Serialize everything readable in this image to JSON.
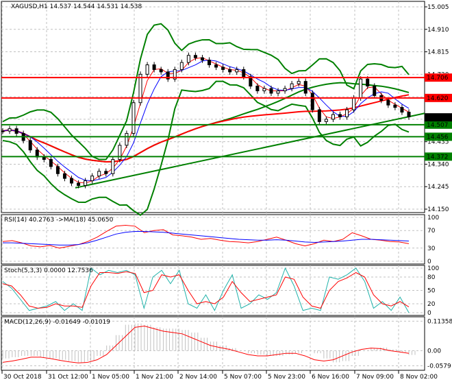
{
  "title": "XAGUSD,H1",
  "ohlc": {
    "open": "14.537",
    "high": "14.544",
    "low": "14.531",
    "close": "14.538"
  },
  "colors": {
    "bull": "#000000",
    "bear": "#000000",
    "band": "#008000",
    "ma": "#ff0000",
    "hline_red": "#ff0000",
    "hline_green": "#008000",
    "rsi": "#ff0000",
    "rsi_ma": "#0000ff",
    "stoch_main": "#20b2aa",
    "stoch_signal": "#ff0000",
    "macd_hist": "#c0c0c0",
    "macd_signal": "#ff0000"
  },
  "chart_data": [
    {
      "type": "candlestick",
      "name": "XAGUSD,H1",
      "ylim": [
        14.15,
        15.005
      ],
      "y_ticks": [
        "15.005",
        "14.910",
        "14.815",
        "14.720",
        "14.625",
        "14.530",
        "14.435",
        "14.340",
        "14.245",
        "14.150"
      ],
      "closes": [
        14.48,
        14.49,
        14.47,
        14.44,
        14.4,
        14.37,
        14.36,
        14.33,
        14.3,
        14.28,
        14.26,
        14.25,
        14.27,
        14.29,
        14.31,
        14.3,
        14.36,
        14.42,
        14.47,
        14.6,
        14.72,
        14.76,
        14.74,
        14.73,
        14.7,
        14.74,
        14.77,
        14.8,
        14.79,
        14.78,
        14.76,
        14.75,
        14.74,
        14.73,
        14.74,
        14.71,
        14.67,
        14.65,
        14.66,
        14.64,
        14.65,
        14.66,
        14.68,
        14.69,
        14.64,
        14.57,
        14.52,
        14.53,
        14.55,
        14.54,
        14.57,
        14.62,
        14.7,
        14.67,
        14.63,
        14.61,
        14.59,
        14.58,
        14.56,
        14.54
      ],
      "levels": [
        {
          "value": "14.706",
          "color": "red"
        },
        {
          "value": "14.620",
          "color": "red"
        },
        {
          "value": "14.507",
          "color": "green"
        },
        {
          "value": "14.456",
          "color": "green"
        },
        {
          "value": "14.372",
          "color": "green"
        }
      ],
      "current": "14.538"
    },
    {
      "type": "line",
      "name": "RSI(14)",
      "label": "RSI(14) 40.2763  ->MA(18) 45.0650",
      "ylim": [
        0,
        100
      ],
      "y_ticks": [
        "100",
        "70",
        "30",
        "0"
      ],
      "rsi": [
        45,
        47,
        42,
        35,
        33,
        36,
        30,
        34,
        38,
        45,
        55,
        68,
        80,
        82,
        80,
        65,
        70,
        72,
        60,
        58,
        55,
        50,
        52,
        48,
        45,
        44,
        42,
        45,
        50,
        55,
        48,
        40,
        35,
        40,
        48,
        45,
        50,
        65,
        58,
        50,
        48,
        45,
        44,
        40
      ],
      "ma": [
        42,
        42,
        41,
        40,
        39,
        38,
        37,
        37,
        38,
        42,
        48,
        55,
        62,
        66,
        68,
        68,
        67,
        66,
        64,
        62,
        60,
        58,
        56,
        54,
        52,
        50,
        49,
        48,
        48,
        49,
        48,
        46,
        44,
        43,
        44,
        45,
        46,
        48,
        50,
        50,
        49,
        48,
        47,
        46
      ]
    },
    {
      "type": "line",
      "name": "Stoch(5,3,3)",
      "label": "Stoch(5,3,3) 0.0000 12.7536",
      "ylim": [
        0,
        100
      ],
      "y_ticks": [
        "100",
        "80",
        "50",
        "20",
        "0"
      ],
      "main": [
        70,
        55,
        30,
        5,
        10,
        15,
        25,
        5,
        20,
        5,
        100,
        85,
        95,
        90,
        95,
        85,
        10,
        80,
        95,
        65,
        95,
        20,
        10,
        40,
        5,
        50,
        85,
        10,
        20,
        40,
        30,
        45,
        100,
        60,
        5,
        10,
        5,
        80,
        75,
        85,
        100,
        70,
        10,
        25,
        5,
        35,
        0
      ],
      "signal": [
        65,
        60,
        40,
        15,
        10,
        12,
        20,
        15,
        15,
        12,
        60,
        90,
        90,
        88,
        92,
        88,
        45,
        50,
        85,
        80,
        85,
        50,
        20,
        25,
        20,
        35,
        70,
        45,
        25,
        30,
        35,
        40,
        80,
        75,
        35,
        15,
        10,
        50,
        70,
        78,
        90,
        80,
        40,
        20,
        15,
        25,
        13
      ]
    },
    {
      "type": "bar+line",
      "name": "MACD(12,26,9)",
      "label": "MACD(12,26,9) -0.01649 -0.01019",
      "ylim": [
        -0.065,
        0.12
      ],
      "y_ticks": [
        "0.11358",
        "0.00",
        "-0.0579"
      ],
      "hist": [
        -0.03,
        -0.025,
        -0.02,
        -0.02,
        -0.025,
        -0.03,
        -0.035,
        -0.04,
        -0.045,
        -0.04,
        -0.02,
        0.02,
        0.06,
        0.1,
        0.105,
        0.1,
        0.09,
        0.085,
        0.085,
        0.08,
        0.07,
        0.05,
        0.035,
        0.02,
        0.01,
        0.0,
        -0.01,
        -0.015,
        -0.02,
        -0.02,
        -0.015,
        -0.01,
        0.0,
        -0.01,
        -0.03,
        -0.045,
        -0.04,
        -0.02,
        0.0,
        0.01,
        0.012,
        0.005,
        -0.005,
        -0.0165
      ],
      "signal": [
        -0.045,
        -0.04,
        -0.033,
        -0.025,
        -0.025,
        -0.03,
        -0.037,
        -0.043,
        -0.047,
        -0.045,
        -0.035,
        -0.015,
        0.02,
        0.055,
        0.09,
        0.095,
        0.085,
        0.075,
        0.07,
        0.065,
        0.05,
        0.035,
        0.02,
        0.012,
        0.005,
        -0.005,
        -0.015,
        -0.02,
        -0.02,
        -0.015,
        -0.01,
        -0.01,
        -0.02,
        -0.035,
        -0.04,
        -0.035,
        -0.02,
        -0.005,
        0.005,
        0.01,
        0.008,
        0.0,
        -0.005,
        -0.0102
      ]
    }
  ],
  "time_labels": [
    "30 Oct 2018",
    "31 Oct 12:00",
    "1 Nov 05:00",
    "1 Nov 21:00",
    "2 Nov 14:00",
    "5 Nov 07:00",
    "5 Nov 23:00",
    "6 Nov 16:00",
    "7 Nov 09:00",
    "8 Nov 02:00"
  ]
}
